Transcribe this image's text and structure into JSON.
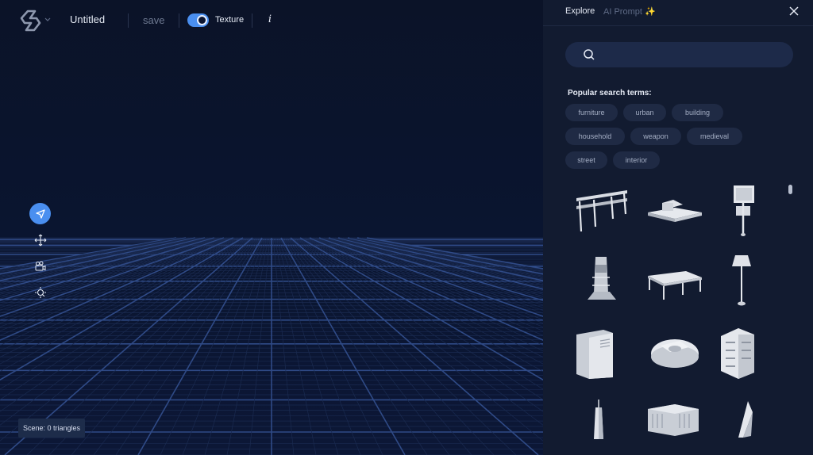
{
  "app": {
    "title": "Untitled"
  },
  "toolbar": {
    "save_label": "save",
    "texture_label": "Texture",
    "texture_enabled": true,
    "info_label": "i"
  },
  "tools": [
    "select-tool",
    "move-tool",
    "camera-tool",
    "zoom-tool"
  ],
  "scene_info": "Scene: 0 triangles",
  "panel": {
    "tabs": [
      {
        "label": "Explore",
        "active": true
      },
      {
        "label": "AI Prompt ✨",
        "active": false
      }
    ],
    "search": {
      "value": "",
      "placeholder": ""
    },
    "popular_title": "Popular search terms:",
    "popular_terms": [
      "furniture",
      "urban",
      "building",
      "household",
      "weapon",
      "medieval",
      "street",
      "interior"
    ],
    "results": [
      {
        "name": "bench"
      },
      {
        "name": "low-building"
      },
      {
        "name": "signpost"
      },
      {
        "name": "tower-ornament"
      },
      {
        "name": "stage-platform"
      },
      {
        "name": "floor-lamp"
      },
      {
        "name": "cabinet"
      },
      {
        "name": "capsule"
      },
      {
        "name": "townhouse"
      },
      {
        "name": "skyscraper"
      },
      {
        "name": "city-block"
      },
      {
        "name": "crystal"
      }
    ]
  },
  "colors": {
    "accent": "#4a8ff0",
    "background": "#0a1226",
    "panel": "#121b30"
  }
}
